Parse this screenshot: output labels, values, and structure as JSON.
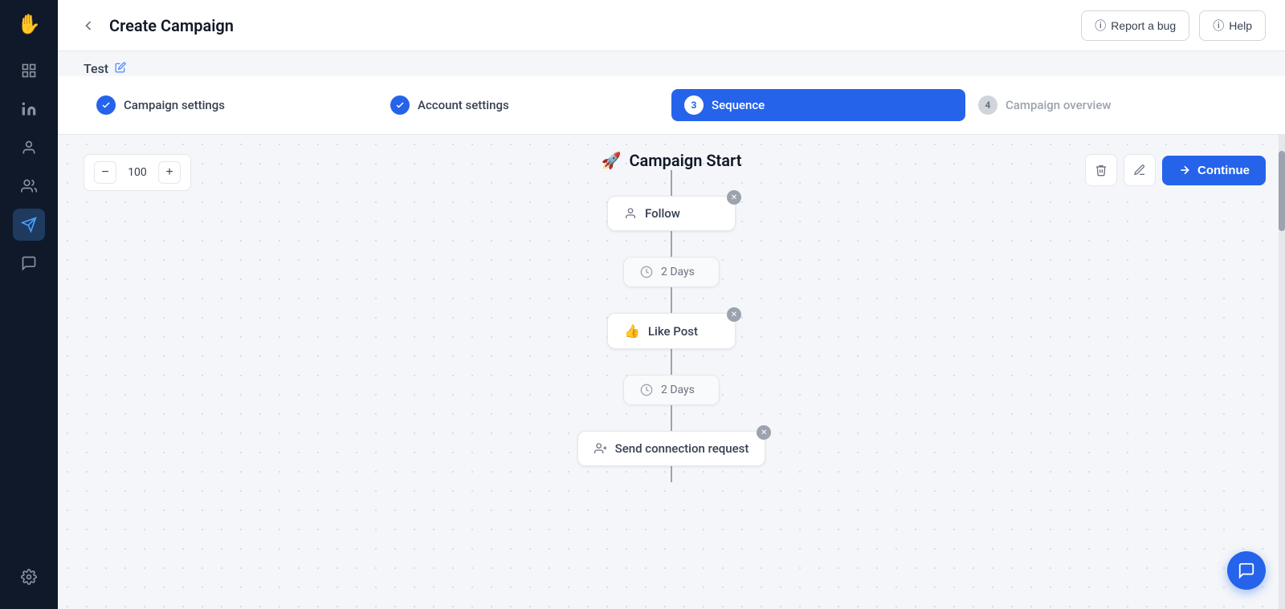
{
  "sidebar": {
    "logo_icon": "✋",
    "items": [
      {
        "id": "dashboard",
        "icon": "📊",
        "active": false
      },
      {
        "id": "linkedin",
        "icon": "in",
        "active": false
      },
      {
        "id": "contacts",
        "icon": "👤",
        "active": false
      },
      {
        "id": "network",
        "icon": "👥",
        "active": false
      },
      {
        "id": "campaigns",
        "icon": "✈",
        "active": true
      },
      {
        "id": "messages",
        "icon": "💬",
        "active": false
      }
    ],
    "settings_icon": "⚙"
  },
  "header": {
    "back_label": "‹",
    "title": "Create Campaign",
    "report_bug_label": "Report a bug",
    "help_label": "Help",
    "info_icon": "ⓘ",
    "help_icon": "ⓘ"
  },
  "test_label": {
    "text": "Test",
    "edit_icon": "✏"
  },
  "steps": [
    {
      "id": "campaign-settings",
      "number": "✓",
      "label": "Campaign settings",
      "state": "completed"
    },
    {
      "id": "account-settings",
      "number": "✓",
      "label": "Account settings",
      "state": "completed"
    },
    {
      "id": "sequence",
      "number": "3",
      "label": "Sequence",
      "state": "active"
    },
    {
      "id": "campaign-overview",
      "number": "4",
      "label": "Campaign overview",
      "state": "inactive"
    }
  ],
  "sequence": {
    "zoom_value": "100",
    "zoom_minus": "−",
    "zoom_plus": "+",
    "campaign_start_icon": "🚀",
    "campaign_start_label": "Campaign Start",
    "nodes": [
      {
        "id": "follow",
        "type": "action",
        "icon": "👤",
        "label": "Follow",
        "removable": true
      },
      {
        "id": "delay1",
        "type": "delay",
        "icon": "🕐",
        "label": "2 Days"
      },
      {
        "id": "like-post",
        "type": "action",
        "icon": "👍",
        "label": "Like Post",
        "removable": true
      },
      {
        "id": "delay2",
        "type": "delay",
        "icon": "🕐",
        "label": "2 Days"
      },
      {
        "id": "send-connection",
        "type": "action",
        "icon": "👤",
        "label": "Send connection request",
        "removable": true
      }
    ],
    "delete_btn_icon": "🗑",
    "edit_btn_icon": "✏",
    "continue_btn_label": "Continue",
    "continue_btn_icon": "→"
  }
}
